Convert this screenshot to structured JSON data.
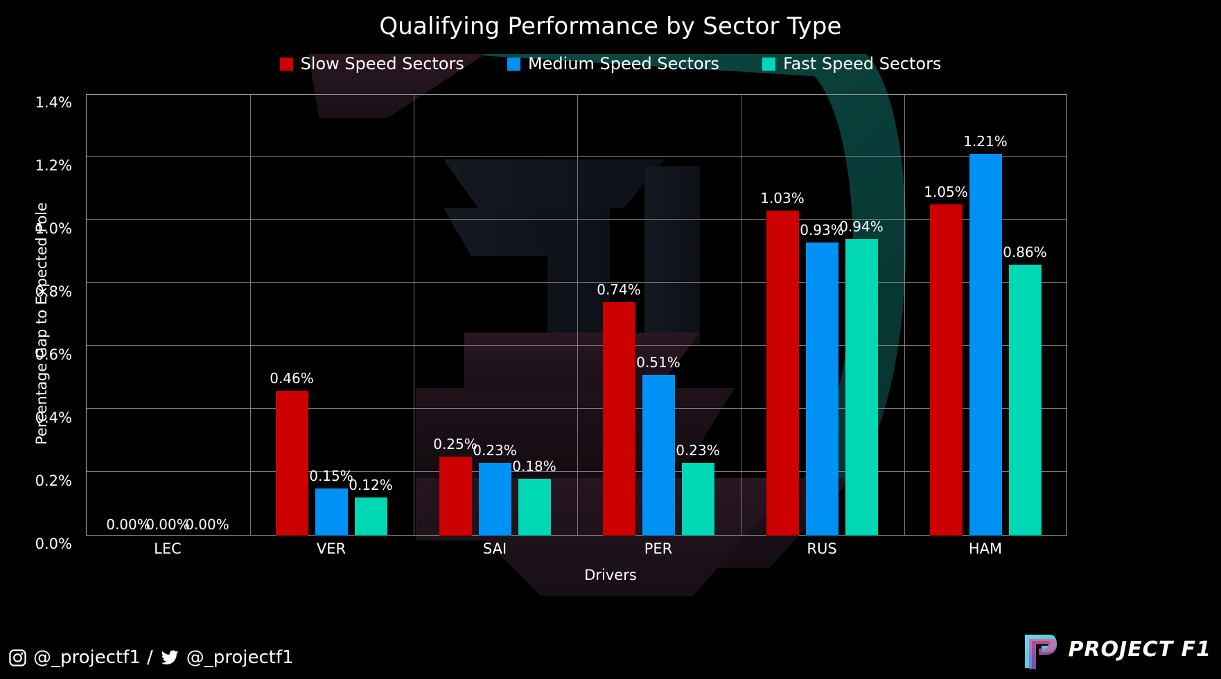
{
  "chart_data": {
    "type": "bar",
    "title": "Qualifying Performance by Sector Type",
    "xlabel": "Drivers",
    "ylabel": "Percentage Gap to Expected Pole",
    "categories": [
      "LEC",
      "VER",
      "SAI",
      "PER",
      "RUS",
      "HAM"
    ],
    "ylim": [
      0.0,
      1.4
    ],
    "ytick_values": [
      0.0,
      0.2,
      0.4,
      0.6,
      0.8,
      1.0,
      1.2,
      1.4
    ],
    "ytick_labels": [
      "0.0%",
      "0.2%",
      "0.4%",
      "0.6%",
      "0.8%",
      "1.0%",
      "1.2%",
      "1.4%"
    ],
    "grid": true,
    "legend_position": "top-center",
    "series": [
      {
        "name": "Slow Speed Sectors",
        "color": "#CC0000",
        "values": [
          0.0,
          0.46,
          0.25,
          0.74,
          1.03,
          1.05
        ],
        "labels": [
          "0.00%",
          "0.46%",
          "0.25%",
          "0.74%",
          "1.03%",
          "1.05%"
        ]
      },
      {
        "name": "Medium Speed Sectors",
        "color": "#0091F5",
        "values": [
          0.0,
          0.15,
          0.23,
          0.51,
          0.93,
          1.21
        ],
        "labels": [
          "0.00%",
          "0.15%",
          "0.23%",
          "0.51%",
          "0.93%",
          "1.21%"
        ]
      },
      {
        "name": "Fast Speed Sectors",
        "color": "#00D7B4",
        "values": [
          0.0,
          0.12,
          0.18,
          0.23,
          0.94,
          0.86
        ],
        "labels": [
          "0.00%",
          "0.12%",
          "0.18%",
          "0.23%",
          "0.94%",
          "0.86%"
        ]
      }
    ]
  },
  "footer": {
    "instagram_handle": "@_projectf1",
    "separator": "/",
    "twitter_handle": "@_projectf1",
    "brand_name": "PROJECT F1"
  },
  "theme": {
    "background": "#000000",
    "text": "#ffffff",
    "grid": "#8d8d8d",
    "axis": "#9a9a9a"
  }
}
